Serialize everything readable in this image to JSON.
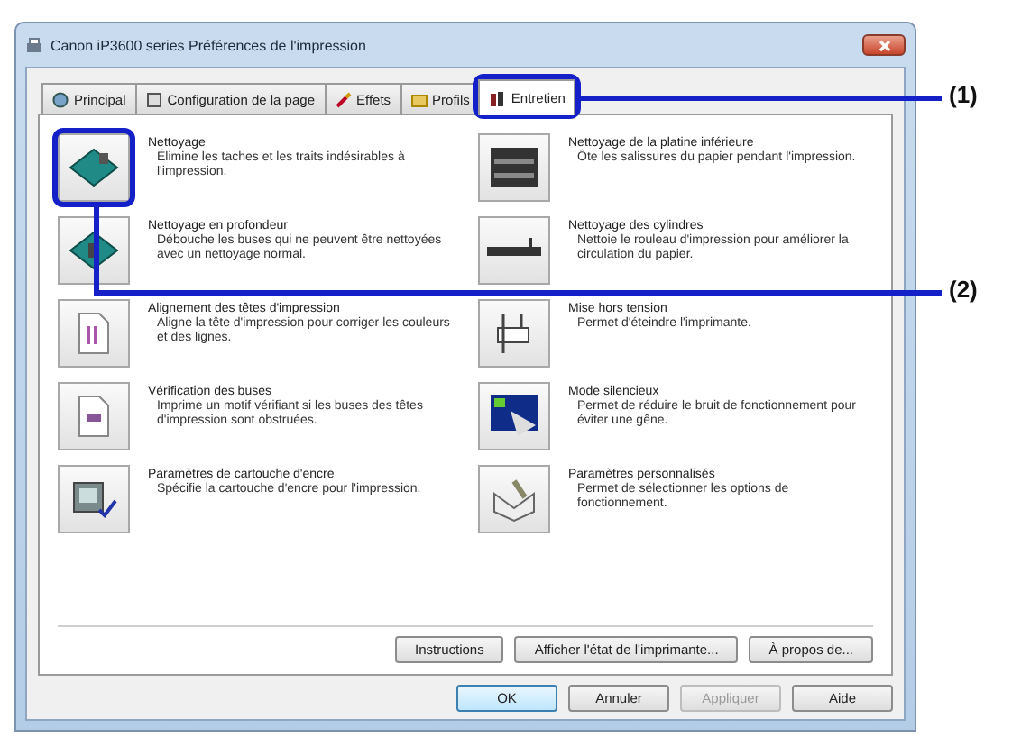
{
  "window": {
    "title": "Canon iP3600 series Préférences de l'impression"
  },
  "tabs": [
    {
      "label": "Principal",
      "selected": false
    },
    {
      "label": "Configuration de la page",
      "selected": false
    },
    {
      "label": "Effets",
      "selected": false
    },
    {
      "label": "Profils",
      "selected": false
    },
    {
      "label": "Entretien",
      "selected": true
    }
  ],
  "functions_left": [
    {
      "title": "Nettoyage",
      "description": "Élimine les taches et les traits indésirables à l'impression."
    },
    {
      "title": "Nettoyage en profondeur",
      "description": "Débouche les buses qui ne peuvent être nettoyées avec un nettoyage normal."
    },
    {
      "title": "Alignement des têtes d'impression",
      "description": "Aligne la tête d'impression pour corriger les couleurs et des lignes."
    },
    {
      "title": "Vérification des buses",
      "description": "Imprime un motif vérifiant si les buses des têtes d'impression sont obstruées."
    },
    {
      "title": "Paramètres de cartouche d'encre",
      "description": "Spécifie la cartouche d'encre pour l'impression."
    }
  ],
  "functions_right": [
    {
      "title": "Nettoyage de la platine inférieure",
      "description": "Ôte les salissures du papier pendant l'impression."
    },
    {
      "title": "Nettoyage des cylindres",
      "description": "Nettoie le rouleau d'impression pour améliorer la circulation du papier."
    },
    {
      "title": "Mise hors tension",
      "description": "Permet d'éteindre l'imprimante."
    },
    {
      "title": "Mode silencieux",
      "description": "Permet de réduire le bruit de fonctionnement pour éviter une gêne."
    },
    {
      "title": "Paramètres personnalisés",
      "description": "Permet de sélectionner les options de fonctionnement."
    }
  ],
  "panel_buttons": [
    "Instructions",
    "Afficher l'état de l'imprimante...",
    "À propos de..."
  ],
  "dialog_buttons": [
    {
      "label": "OK",
      "default": true,
      "disabled": false
    },
    {
      "label": "Annuler",
      "default": false,
      "disabled": false
    },
    {
      "label": "Appliquer",
      "default": false,
      "disabled": true
    },
    {
      "label": "Aide",
      "default": false,
      "disabled": false
    }
  ],
  "callouts": [
    {
      "label": "(1)"
    },
    {
      "label": "(2)"
    }
  ]
}
